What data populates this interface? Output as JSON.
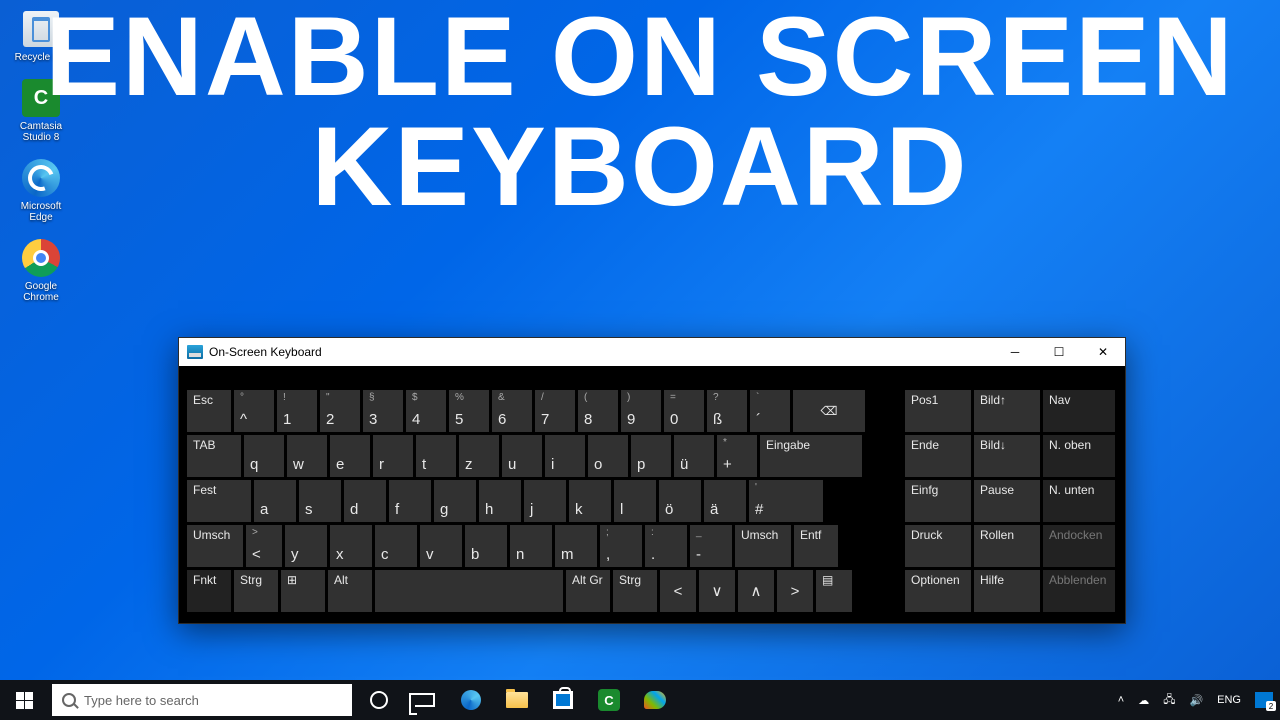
{
  "headline": {
    "line1": "ENABLE ON SCREEN",
    "line2": "KEYBOARD"
  },
  "desktop": {
    "recycle": "Recycle Bin",
    "camtasia": "Camtasia Studio 8",
    "edge": "Microsoft Edge",
    "chrome": "Google Chrome"
  },
  "osk": {
    "title": "On-Screen Keyboard",
    "rows": {
      "r1": [
        "Esc",
        "^",
        "1",
        "2",
        "3",
        "4",
        "5",
        "6",
        "7",
        "8",
        "9",
        "0",
        "ß",
        "´",
        "⌫"
      ],
      "r1sup": [
        "",
        "°",
        "!",
        "\"",
        "§",
        "$",
        "%",
        "&",
        "/",
        "(",
        ")",
        "=",
        "?",
        "`",
        ""
      ],
      "r2": [
        "TAB",
        "q",
        "w",
        "e",
        "r",
        "t",
        "z",
        "u",
        "i",
        "o",
        "p",
        "ü",
        "+",
        "Eingabe"
      ],
      "r2sup": [
        "",
        "",
        "",
        "",
        "",
        "",
        "",
        "",
        "",
        "",
        "",
        "",
        "*",
        ""
      ],
      "r3": [
        "Fest",
        "a",
        "s",
        "d",
        "f",
        "g",
        "h",
        "j",
        "k",
        "l",
        "ö",
        "ä",
        "#"
      ],
      "r3sup": [
        "",
        "",
        "",
        "",
        "",
        "",
        "",
        "",
        "",
        "",
        "",
        "",
        "'"
      ],
      "r4": [
        "Umsch",
        "<",
        "y",
        "x",
        "c",
        "v",
        "b",
        "n",
        "m",
        ",",
        ".",
        "-",
        "Umsch",
        "Entf"
      ],
      "r4sup": [
        "",
        ">",
        "",
        "",
        "",
        "",
        "",
        "",
        "",
        ";",
        ":",
        "_",
        "",
        ""
      ],
      "r5": [
        "Fnkt",
        "Strg",
        "⊞",
        "Alt",
        "",
        "Alt Gr",
        "Strg",
        "<",
        "∨",
        "∧",
        ">",
        "▤"
      ]
    },
    "nav": [
      [
        "Pos1",
        "Bild↑",
        "Nav"
      ],
      [
        "Ende",
        "Bild↓",
        "N. oben"
      ],
      [
        "Einfg",
        "Pause",
        "N. unten"
      ],
      [
        "Druck",
        "Rollen",
        "Andocken"
      ],
      [
        "Optionen",
        "Hilfe",
        "Abblenden"
      ]
    ]
  },
  "taskbar": {
    "search_placeholder": "Type here to search",
    "lang": "ENG",
    "notif_count": "2"
  }
}
